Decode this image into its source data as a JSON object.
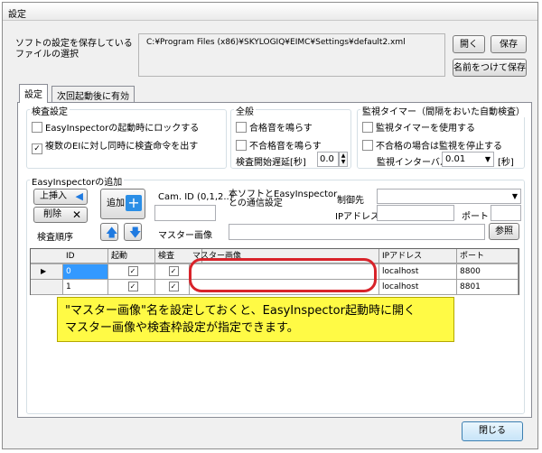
{
  "window": {
    "title": "設定"
  },
  "top": {
    "select_label_line1": "ソフトの設定を保存している",
    "select_label_line2": "ファイルの選択",
    "file_path": "C:¥Program Files (x86)¥SKYLOGIQ¥EIMC¥Settings¥default2.xml",
    "open_label": "開く",
    "save_label": "保存",
    "save_as_label": "名前をつけて保存"
  },
  "tabs": [
    {
      "label": "設定"
    },
    {
      "label": "次回起動後に有効"
    }
  ],
  "inspection": {
    "title": "検査設定",
    "lock_on_start": "EasyInspectorの起動時にロックする",
    "simultaneous": "複数のEIに対し同時に検査命令を出す",
    "lock_checked": false,
    "simultaneous_checked": true
  },
  "general": {
    "title": "全般",
    "pass_sound": "合格音を鳴らす",
    "fail_sound": "不合格音を鳴らす",
    "delay_label": "検査開始遅延[秒]",
    "delay_value": "0.0"
  },
  "monitor": {
    "title": "監視タイマー（間隔をおいた自動検査）",
    "use_timer": "監視タイマーを使用する",
    "stop_on_fail": "不合格の場合は監視を停止する",
    "interval_label": "監視インターバル",
    "interval_value": "0.01",
    "interval_unit": "[秒]"
  },
  "add": {
    "title": "EasyInspectorの追加",
    "insert_up": "上挿入",
    "delete": "削除",
    "order_label": "検査順序",
    "add_label": "追加",
    "cam_id_label": "Cam. ID (0,1,2..)",
    "comm_label_line1": "本ソフトとEasyInspector",
    "comm_label_line2": "との通信設定",
    "control_label": "制御先",
    "ip_label": "IPアドレス",
    "port_label": "ポート",
    "master_label": "マスター画像",
    "browse_label": "参照"
  },
  "table": {
    "headers": [
      "ID",
      "起動",
      "検査",
      "マスター画像",
      "IPアドレス",
      "ポート"
    ],
    "rows": [
      {
        "id": "0",
        "start": true,
        "inspect": true,
        "master": "",
        "ip": "localhost",
        "port": "8800"
      },
      {
        "id": "1",
        "start": true,
        "inspect": true,
        "master": "",
        "ip": "localhost",
        "port": "8801"
      }
    ]
  },
  "annotation": {
    "line1": "\"マスター画像\"名を設定しておくと、EasyInspector起動時に開く",
    "line2": "マスター画像や検査枠設定が指定できます。"
  },
  "footer": {
    "close_label": "閉じる"
  }
}
